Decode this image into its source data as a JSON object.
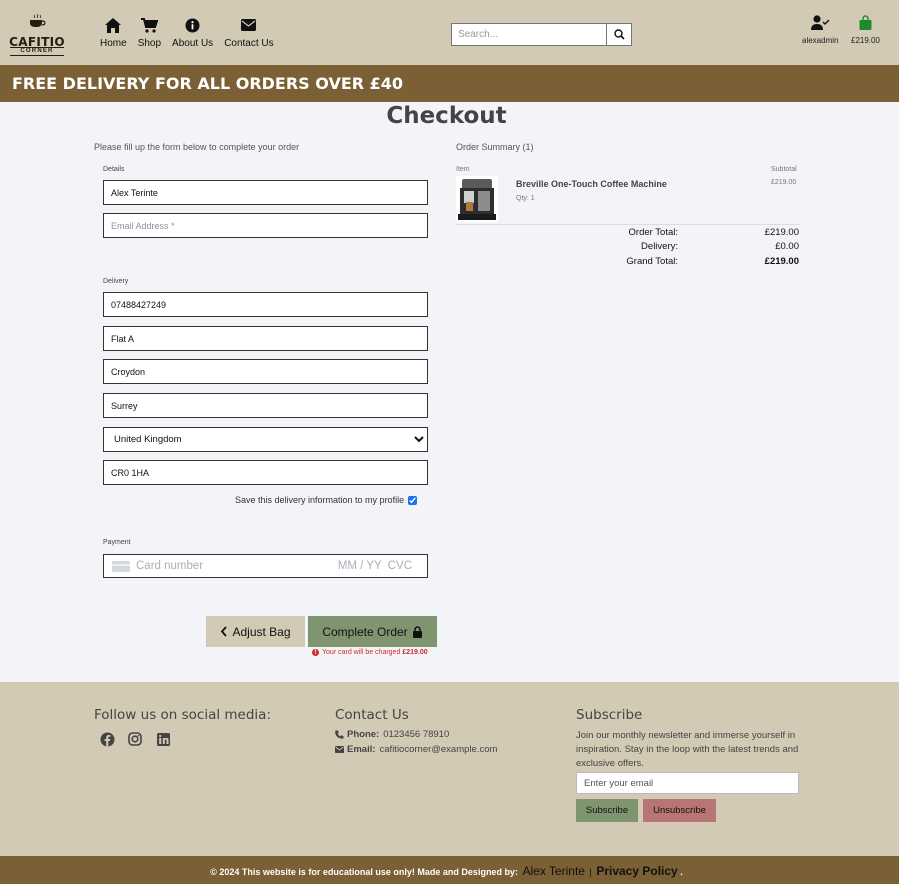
{
  "header": {
    "logo_brand": "CAFITIO",
    "logo_sub": "CORNER",
    "nav": [
      {
        "label": "Home"
      },
      {
        "label": "Shop"
      },
      {
        "label": "About Us"
      },
      {
        "label": "Contact Us"
      }
    ],
    "search_placeholder": "Search...",
    "account_label": "alexadmin",
    "bag_total": "£219.00"
  },
  "banner": {
    "text": "FREE DELIVERY FOR ALL ORDERS OVER £40"
  },
  "checkout": {
    "title": "Checkout",
    "intro": "Please fill up the form below to complete your order",
    "details_legend": "Details",
    "full_name": "Alex Terinte",
    "email_placeholder": "Email Address *",
    "delivery_legend": "Delivery",
    "phone": "07488427249",
    "street_address": "Flat A",
    "town": "Croydon",
    "county": "Surrey",
    "country": "United Kingdom",
    "postcode": "CR0 1HA",
    "save_info_label": "Save this delivery information to my profile",
    "payment_legend": "Payment",
    "card_number_placeholder": "Card number",
    "card_expiry_placeholder": "MM / YY",
    "card_cvc_placeholder": "CVC",
    "adjust_bag_label": "Adjust Bag",
    "complete_order_label": "Complete Order",
    "charge_text": "Your card will be charged",
    "charge_amount": "£219.00"
  },
  "summary": {
    "title": "Order Summary (1)",
    "col_item": "Item",
    "col_subtotal": "Subtotal",
    "product_name": "Breville One-Touch Coffee Machine",
    "product_qty": "Qty: 1",
    "product_subtotal": "£219.00",
    "order_total_label": "Order Total:",
    "order_total": "£219.00",
    "delivery_label": "Delivery:",
    "delivery": "£0.00",
    "grand_total_label": "Grand Total:",
    "grand_total": "£219.00"
  },
  "footer": {
    "social_heading": "Follow us on social media:",
    "contact_heading": "Contact Us",
    "phone_label": "Phone:",
    "phone": "0123456 78910",
    "email_label": "Email:",
    "email": "cafitiocorner@example.com",
    "subscribe_heading": "Subscribe",
    "subscribe_text": "Join our monthly newsletter and immerse yourself in inspiration. Stay in the loop with the latest trends and exclusive offers.",
    "subscribe_placeholder": "Enter your email",
    "subscribe_button": "Subscribe",
    "unsubscribe_button": "Unsubscribe",
    "copyright": "© 2024 This website is for educational use only! Made and Designed by:",
    "author": "Alex Terinte",
    "separator": "|",
    "privacy": "Privacy Policy",
    "trailing": "."
  },
  "colors": {
    "header_bg": "#d2cab5",
    "banner_bg": "#7a6034",
    "page_bg": "#f3f4f8",
    "success_button": "#7f9570",
    "danger_button": "#b87575",
    "bag_icon": "#1e8a2e",
    "charge_warning": "#d12a2a"
  },
  "icons": [
    "coffee-cup-icon",
    "home-icon",
    "shopping-cart-icon",
    "info-circle-icon",
    "envelope-icon",
    "search-icon",
    "user-check-icon",
    "shopping-bag-icon",
    "chevron-left-icon",
    "lock-icon",
    "exclamation-circle-icon",
    "facebook-icon",
    "instagram-icon",
    "linkedin-icon",
    "phone-icon"
  ]
}
